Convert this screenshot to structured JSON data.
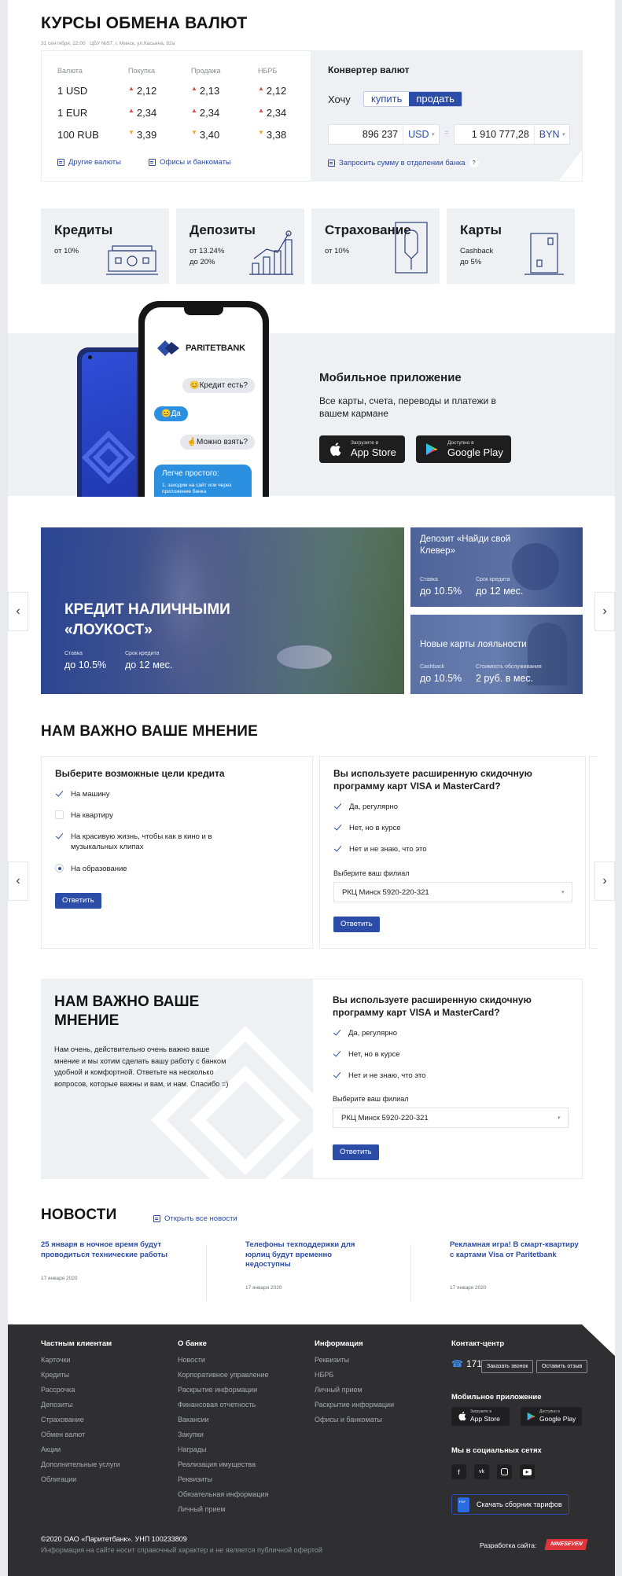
{
  "rates": {
    "title": "КУРСЫ ОБМЕНА ВАЛЮТ",
    "meta": "31 сентября, 22:00   ЦБУ №57, г. Минск, ул.Касьяна, 92а",
    "headers": [
      "Валюта",
      "Покупка",
      "Продажа",
      "НБРБ"
    ],
    "rows": [
      {
        "currency": "1 USD",
        "buy": "2,12",
        "sell": "2,13",
        "nbrb": "2,12",
        "buy_dir": "up",
        "sell_dir": "up",
        "nbrb_dir": "up"
      },
      {
        "currency": "1 EUR",
        "buy": "2,34",
        "sell": "2,34",
        "nbrb": "2,34",
        "buy_dir": "up",
        "sell_dir": "up",
        "nbrb_dir": "up"
      },
      {
        "currency": "100 RUB",
        "buy": "3,39",
        "sell": "3,40",
        "nbrb": "3,38",
        "buy_dir": "down",
        "sell_dir": "down",
        "nbrb_dir": "down"
      }
    ],
    "other_link": "Другие валюты",
    "offices_link": "Офисы и банкоматы"
  },
  "converter": {
    "title": "Конвертер валют",
    "want_label": "Хочу",
    "buy": "купить",
    "sell": "продать",
    "amount_from": "896 237",
    "currency_from": "USD",
    "amount_to": "1 910 777,28",
    "currency_to": "BYN",
    "request_link": "Запросить сумму в отделении банка",
    "help": "?"
  },
  "products": [
    {
      "title": "Кредиты",
      "sub1": "от 10%",
      "sub2": "",
      "icon": "cash-icon"
    },
    {
      "title": "Депозиты",
      "sub1": "от 13.24%",
      "sub2": "до 20%",
      "icon": "growth-chart-icon"
    },
    {
      "title": "Страхование",
      "sub1": "от 10%",
      "sub2": "",
      "icon": "umbrella-icon"
    },
    {
      "title": "Карты",
      "sub1": "Cashback",
      "sub2": "до 5%",
      "icon": "card-icon"
    }
  ],
  "app": {
    "bank_name": "PARITETBANK",
    "chat": [
      "😊Кредит есть?",
      "😊Да",
      "🤞Можно взять?"
    ],
    "chat_card_title": "Легче простого:",
    "chat_card_text": "1. заходим на сайт или через приложение банка",
    "title": "Мобильное приложение",
    "text": "Все карты, счета, переводы и платежи в вашем кармане",
    "appstore_small": "Загрузите в",
    "appstore_big": "App Store",
    "gplay_small": "Доступно в",
    "gplay_big": "Google Play"
  },
  "promos": {
    "main": {
      "title1": "КРЕДИТ НАЛИЧНЫМИ",
      "title2": "«ЛОУКОСТ»",
      "lbl1": "Ставка",
      "val1": "до 10.5%",
      "lbl2": "Срок кредита",
      "val2": "до 12 мес."
    },
    "deposit": {
      "title": "Депозит «Найди свой Клевер»",
      "lbl1": "Ставка",
      "val1": "до 10.5%",
      "lbl2": "Срок кредита",
      "val2": "до 12 мес."
    },
    "loyalty": {
      "title": "Новые карты лояльности",
      "lbl1": "Cashback",
      "val1": "до 10.5%",
      "lbl2": "Стоимость обслуживания",
      "val2": "2 руб. в мес."
    }
  },
  "survey": {
    "title": "НАМ ВАЖНО ВАШЕ МНЕНИЕ",
    "q1": "Выберите возможные цели кредита",
    "q1_options": [
      {
        "label": "На машину",
        "state": "checked"
      },
      {
        "label": "На квартиру",
        "state": "unchecked"
      },
      {
        "label": "На красивую жизнь, чтобы как в кино и в музыкальных клипах",
        "state": "checked"
      },
      {
        "label": "На образование",
        "state": "radio"
      }
    ],
    "q2": "Вы используете расширенную скидочную программу карт VISA и MasterCard?",
    "q2_options": [
      "Да, регулярно",
      "Нет, но в курсе",
      "Нет и не знаю, что это"
    ],
    "branch_label": "Выберите ваш филиал",
    "branch_value": "РКЦ Минск 5920-220-321",
    "submit": "Ответить"
  },
  "opinion": {
    "title": "НАМ ВАЖНО ВАШЕ МНЕНИЕ",
    "text": "Нам очень, действительно очень важно ваше мнение и мы хотим сделать вашу работу с банком удобной и комфортной. Ответьте на несколько вопросов, которые важны и вам, и нам. Спасибо =)",
    "q": "Вы используете расширенную скидочную программу карт VISA и MasterCard?",
    "options": [
      "Да, регулярно",
      "Нет, но в курсе",
      "Нет и не знаю, что это"
    ],
    "branch_label": "Выберите ваш филиал",
    "branch_value": "РКЦ Минск 5920-220-321",
    "submit": "Ответить"
  },
  "news": {
    "title": "НОВОСТИ",
    "all_link": "Открыть все новости",
    "items": [
      {
        "title": "25 января в ночное время будут проводиться технические работы",
        "date": "17 января 2020"
      },
      {
        "title": "Телефоны техподдержки для юрлиц будут временно недоступны",
        "date": "17 января 2020"
      },
      {
        "title": "Рекламная игра! В смарт-квартиру с картами Visa от Paritetbank",
        "date": "17 января 2020"
      }
    ]
  },
  "footer": {
    "cols": [
      {
        "title": "Частным клиентам",
        "items": [
          "Карточки",
          "Кредиты",
          "Рассрочка",
          "Депозиты",
          "Страхование",
          "Обмен валют",
          "Акции",
          "Дополнительные услуги",
          "Облигации"
        ]
      },
      {
        "title": "О банке",
        "items": [
          "Новости",
          "Корпоративное управление",
          "Раскрытие информации",
          "Финансовая отчетность",
          "Вакансии",
          "Закупки",
          "Награды",
          "Реализация имущества",
          "Реквизиты",
          "Обязательная информация",
          "Личный прием"
        ]
      },
      {
        "title": "Информация",
        "items": [
          "Реквизиты",
          "НБРБ",
          "Личный прием",
          "Раскрытие информации",
          "Офисы и банкоматы"
        ]
      }
    ],
    "contact_title": "Контакт-центр",
    "phone": "171",
    "call_btn": "Заказать звонок",
    "review_btn": "Оставить отзыв",
    "app_title": "Мобильное приложение",
    "appstore_small": "Загрузите в",
    "appstore_big": "App Store",
    "gplay_small": "Доступно в",
    "gplay_big": "Google Play",
    "social_title": "Мы в социальных сетях",
    "tariffs": "Скачать сборник тарифов",
    "copyright": "©2020 ОАО «Паритетбанк». УНП 100233809",
    "disclaimer": "Информация на сайте носит справочный характер и не является публичной офертой",
    "dev_label": "Разработка сайта:",
    "dev_logo": "NINESEVEN"
  },
  "colors": {
    "accent": "#2b4ca7",
    "bg_light": "#eef0f4",
    "footer": "#2f2f31",
    "up": "#e0464a",
    "down": "#f3a530"
  }
}
